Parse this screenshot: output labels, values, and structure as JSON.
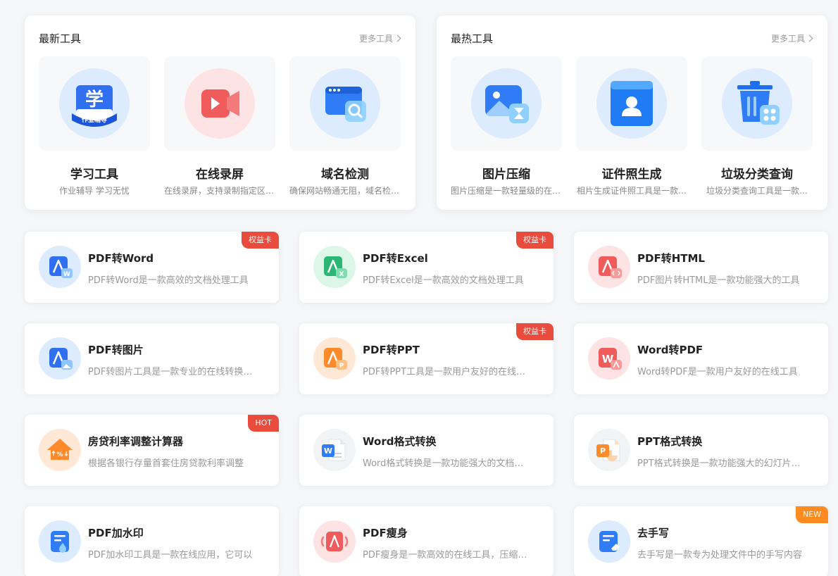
{
  "newest_tools": {
    "title": "最新工具",
    "more": "更多工具",
    "items": [
      {
        "name": "学习工具",
        "desc": "作业辅导 学习无忧",
        "icon": "study-book-icon",
        "icon_text_main": "学",
        "icon_text_sub": "作业辅导"
      },
      {
        "name": "在线录屏",
        "desc": "在线录屏，支持录制指定区域…",
        "icon": "video-camera-icon"
      },
      {
        "name": "域名检测",
        "desc": "确保网站畅通无阻，域名检测…",
        "icon": "browser-search-icon"
      }
    ]
  },
  "hot_tools": {
    "title": "最热工具",
    "more": "更多工具",
    "items": [
      {
        "name": "图片压缩",
        "desc": "图片压缩是一款轻量级的在线…",
        "icon": "image-compress-icon"
      },
      {
        "name": "证件照生成",
        "desc": "相片生成证件照工具是一款…",
        "icon": "id-photo-icon"
      },
      {
        "name": "垃圾分类查询",
        "desc": "垃圾分类查询工具是一款…",
        "icon": "trash-classify-icon"
      }
    ]
  },
  "cards": [
    {
      "title": "PDF转Word",
      "desc": "PDF转Word是一款高效的文档处理工具",
      "badge": "权益卡",
      "icon": "pdf-to-word-icon"
    },
    {
      "title": "PDF转Excel",
      "desc": "PDF转Excel是一款高效的文档处理工具",
      "badge": "权益卡",
      "icon": "pdf-to-excel-icon"
    },
    {
      "title": "PDF转HTML",
      "desc": "PDF图片转HTML是一款功能强大的工具",
      "badge": "",
      "icon": "pdf-to-html-icon"
    },
    {
      "title": "PDF转图片",
      "desc": "PDF转图片工具是一款专业的在线转换工具",
      "badge": "",
      "icon": "pdf-to-image-icon"
    },
    {
      "title": "PDF转PPT",
      "desc": "PDF转PPT工具是一款用户友好的在线工具",
      "badge": "权益卡",
      "icon": "pdf-to-ppt-icon"
    },
    {
      "title": "Word转PDF",
      "desc": "Word转PDF是一款用户友好的在线工具",
      "badge": "",
      "icon": "word-to-pdf-icon"
    },
    {
      "title": "房贷利率调整计算器",
      "desc": "根据各银行存量首套住房贷款利率调整",
      "badge": "HOT",
      "icon": "house-rate-icon"
    },
    {
      "title": "Word格式转换",
      "desc": "Word格式转换是一款功能强大的文档工具",
      "badge": "",
      "icon": "word-format-icon"
    },
    {
      "title": "PPT格式转换",
      "desc": "PPT格式转换是一款功能强大的幻灯片工具",
      "badge": "",
      "icon": "ppt-format-icon"
    },
    {
      "title": "PDF加水印",
      "desc": "PDF加水印工具是一款在线应用，它可以",
      "badge": "",
      "icon": "pdf-watermark-icon"
    },
    {
      "title": "PDF瘦身",
      "desc": "PDF瘦身是一款高效的在线工具，压缩文件",
      "badge": "",
      "icon": "pdf-compress-icon"
    },
    {
      "title": "去手写",
      "desc": "去手写是一款专为处理文件中的手写内容",
      "badge": "NEW",
      "icon": "remove-handwriting-icon"
    }
  ]
}
